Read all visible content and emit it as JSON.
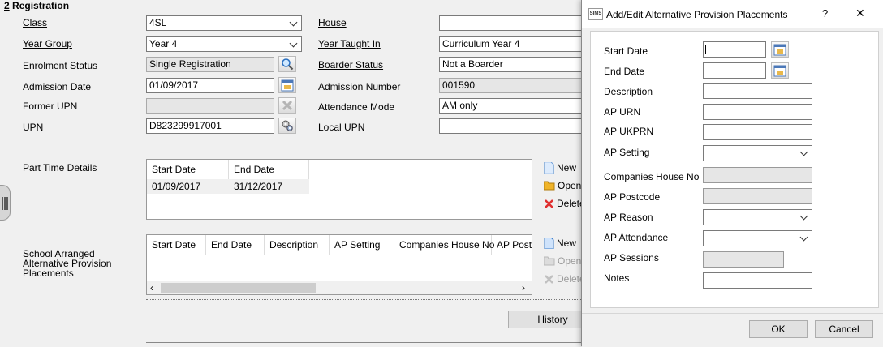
{
  "section": {
    "number": "2",
    "title": "Registration"
  },
  "form": {
    "class_label": "Class",
    "class_value": "4SL",
    "year_group_label": "Year Group",
    "year_group_value": "Year  4",
    "enrolment_label": "Enrolment Status",
    "enrolment_value": "Single Registration",
    "admission_date_label": "Admission Date",
    "admission_date_value": "01/09/2017",
    "former_upn_label": "Former UPN",
    "former_upn_value": "",
    "upn_label": "UPN",
    "upn_value": "D823299917001",
    "house_label": "House",
    "house_value": "",
    "year_taught_label": "Year Taught In",
    "year_taught_value": "Curriculum Year  4",
    "boarder_label": "Boarder Status",
    "boarder_value": "Not a Boarder",
    "admission_number_label": "Admission Number",
    "admission_number_value": "001590",
    "attendance_mode_label": "Attendance Mode",
    "attendance_mode_value": "AM only",
    "local_upn_label": "Local UPN",
    "local_upn_value": ""
  },
  "part_time": {
    "label": "Part Time Details",
    "columns": [
      "Start Date",
      "End Date"
    ],
    "rows": [
      [
        "01/09/2017",
        "31/12/2017"
      ]
    ],
    "actions": {
      "new": "New",
      "open": "Open",
      "delete": "Delete"
    }
  },
  "ap_placements": {
    "label": "School Arranged Alternative Provision Placements",
    "columns": [
      "Start Date",
      "End Date",
      "Description",
      "AP Setting",
      "Companies House No",
      "AP Postc"
    ],
    "actions": {
      "new": "New",
      "open": "Open",
      "delete": "Delete"
    }
  },
  "history_button": "History",
  "dialog": {
    "app_icon": "SIMS",
    "title": "Add/Edit Alternative Provision Placements",
    "help": "?",
    "close": "✕",
    "fields": [
      {
        "label": "Start Date"
      },
      {
        "label": "End Date"
      },
      {
        "label": "Description"
      },
      {
        "label": "AP URN"
      },
      {
        "label": "AP UKPRN"
      },
      {
        "label": "AP Setting"
      },
      {
        "label": "Companies House No"
      },
      {
        "label": "AP Postcode"
      },
      {
        "label": "AP Reason"
      },
      {
        "label": "AP Attendance"
      },
      {
        "label": "AP Sessions"
      },
      {
        "label": "Notes"
      }
    ],
    "ok": "OK",
    "cancel": "Cancel"
  }
}
